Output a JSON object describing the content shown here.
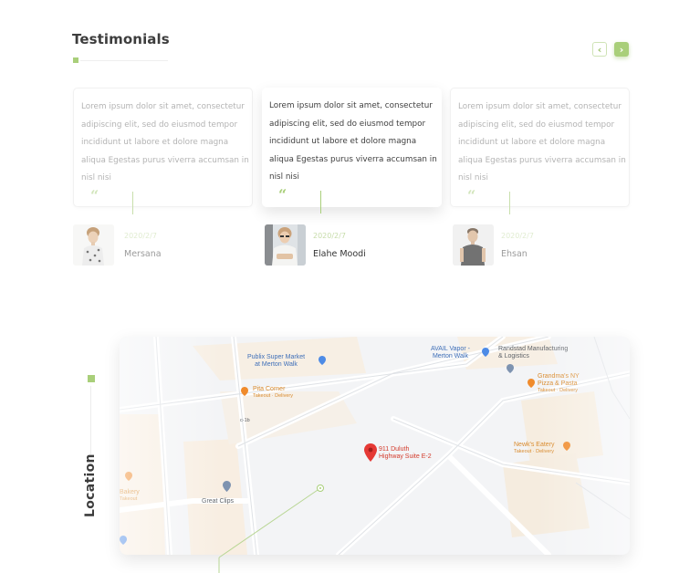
{
  "section": {
    "title": "Testimonials",
    "nav": {
      "prev": "‹",
      "next": "›"
    }
  },
  "testimonials": [
    {
      "text": "Lorem ipsum dolor sit amet, consectetur adipiscing elit, sed do eiusmod tempor incididunt ut labore et dolore magna aliqua Egestas purus viverra accumsan in nisl nisi",
      "date": "2020/2/7",
      "name": "Mersana",
      "quote": "“"
    },
    {
      "text": "Lorem ipsum dolor sit amet, consectetur adipiscing elit, sed do eiusmod tempor incididunt ut labore et dolore magna aliqua Egestas purus viverra accumsan in nisl nisi",
      "date": "2020/2/7",
      "name": "Elahe Moodi",
      "quote": "“"
    },
    {
      "text": "Lorem ipsum dolor sit amet, consectetur adipiscing elit, sed do eiusmod tempor incididunt ut labore et dolore magna aliqua Egestas purus viverra accumsan in nisl nisi",
      "date": "2020/2/7",
      "name": "Ehsan",
      "quote": "“"
    }
  ],
  "location": {
    "label": "Location",
    "map": {
      "pois": {
        "publix_line1": "Publix Super Market",
        "publix_line2": "at Merton Walk",
        "avail_line1": "AVAIL Vapor -",
        "avail_line2": "Merton Walk",
        "randstad_line1": "Randstad Manufacturing",
        "randstad_line2": "& Logistics",
        "grandma_line1": "Grandma's NY",
        "grandma_line2": "Pizza & Pasta",
        "grandma_sub": "Takeout · Delivery",
        "pita_line1": "Pita Corner",
        "pita_sub": "Takeout · Delivery",
        "road_label": "c-1b",
        "newks_line1": "Newk's Eatery",
        "newks_sub": "Takeout · Delivery",
        "bakery_line1": "Bakery",
        "bakery_sub": "Takeout",
        "great_clips": "Great Clips",
        "address_line1": "911 Duluth",
        "address_line2": "Highway Suite E-2"
      }
    }
  },
  "colors": {
    "accent": "#a9cf7a",
    "heading": "#3d3d3d",
    "pin_red": "#d33b2c",
    "poi_blue": "#3f6fb8",
    "poi_orange": "#d98a2c"
  }
}
